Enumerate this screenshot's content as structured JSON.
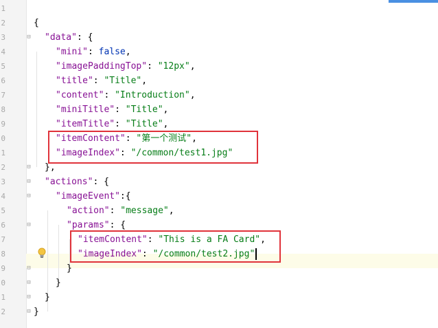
{
  "editor": {
    "line_numbers": [
      "1",
      "2",
      "3",
      "4",
      "5",
      "6",
      "7",
      "8",
      "9",
      "0",
      "1",
      "2",
      "3",
      "4",
      "5",
      "6",
      "7",
      "8",
      "9",
      "0",
      "1",
      "2"
    ],
    "lines": [
      [],
      [
        {
          "t": "{",
          "c": "p"
        }
      ],
      [
        {
          "t": "\"data\"",
          "c": "key"
        },
        {
          "t": ": {",
          "c": "p"
        }
      ],
      [
        {
          "t": "\"mini\"",
          "c": "key"
        },
        {
          "t": ": ",
          "c": "p"
        },
        {
          "t": "false",
          "c": "kw"
        },
        {
          "t": ",",
          "c": "p"
        }
      ],
      [
        {
          "t": "\"imagePaddingTop\"",
          "c": "key"
        },
        {
          "t": ": ",
          "c": "p"
        },
        {
          "t": "\"12px\"",
          "c": "str"
        },
        {
          "t": ",",
          "c": "p"
        }
      ],
      [
        {
          "t": "\"title\"",
          "c": "key"
        },
        {
          "t": ": ",
          "c": "p"
        },
        {
          "t": "\"Title\"",
          "c": "str"
        },
        {
          "t": ",",
          "c": "p"
        }
      ],
      [
        {
          "t": "\"content\"",
          "c": "key"
        },
        {
          "t": ": ",
          "c": "p"
        },
        {
          "t": "\"Introduction\"",
          "c": "str"
        },
        {
          "t": ",",
          "c": "p"
        }
      ],
      [
        {
          "t": "\"miniTitle\"",
          "c": "key"
        },
        {
          "t": ": ",
          "c": "p"
        },
        {
          "t": "\"Title\"",
          "c": "str"
        },
        {
          "t": ",",
          "c": "p"
        }
      ],
      [
        {
          "t": "\"itemTitle\"",
          "c": "key"
        },
        {
          "t": ": ",
          "c": "p"
        },
        {
          "t": "\"Title\"",
          "c": "str"
        },
        {
          "t": ",",
          "c": "p"
        }
      ],
      [
        {
          "t": "\"itemContent\"",
          "c": "key"
        },
        {
          "t": ": ",
          "c": "p"
        },
        {
          "t": "\"第一个测试\"",
          "c": "str"
        },
        {
          "t": ",",
          "c": "p"
        }
      ],
      [
        {
          "t": "\"imageIndex\"",
          "c": "key"
        },
        {
          "t": ": ",
          "c": "p"
        },
        {
          "t": "\"/common/test1.jpg\"",
          "c": "str"
        }
      ],
      [
        {
          "t": "},",
          "c": "p"
        }
      ],
      [
        {
          "t": "\"actions\"",
          "c": "key"
        },
        {
          "t": ": {",
          "c": "p"
        }
      ],
      [
        {
          "t": "\"imageEvent\"",
          "c": "key"
        },
        {
          "t": ":{",
          "c": "p"
        }
      ],
      [
        {
          "t": "\"action\"",
          "c": "key"
        },
        {
          "t": ": ",
          "c": "p"
        },
        {
          "t": "\"message\"",
          "c": "str"
        },
        {
          "t": ",",
          "c": "p"
        }
      ],
      [
        {
          "t": "\"params\"",
          "c": "key"
        },
        {
          "t": ": {",
          "c": "p"
        }
      ],
      [
        {
          "t": "\"itemContent\"",
          "c": "key"
        },
        {
          "t": ": ",
          "c": "p"
        },
        {
          "t": "\"This is a FA Card\"",
          "c": "str"
        },
        {
          "t": ",",
          "c": "p"
        }
      ],
      [
        {
          "t": "\"imageIndex\"",
          "c": "key"
        },
        {
          "t": ": ",
          "c": "p"
        },
        {
          "t": "\"/common/test2.jpg\"",
          "c": "str"
        }
      ],
      [
        {
          "t": "}",
          "c": "p"
        }
      ],
      [
        {
          "t": "}",
          "c": "p"
        }
      ],
      [
        {
          "t": "}",
          "c": "p"
        }
      ],
      [
        {
          "t": "}",
          "c": "p"
        }
      ]
    ]
  },
  "icons": {
    "fold_marker": "fold-icon",
    "intention_bulb": "lightbulb-icon"
  },
  "colors": {
    "highlight_box": "#e0323a",
    "key": "#871094",
    "string": "#067d17",
    "keyword": "#0033b3"
  }
}
